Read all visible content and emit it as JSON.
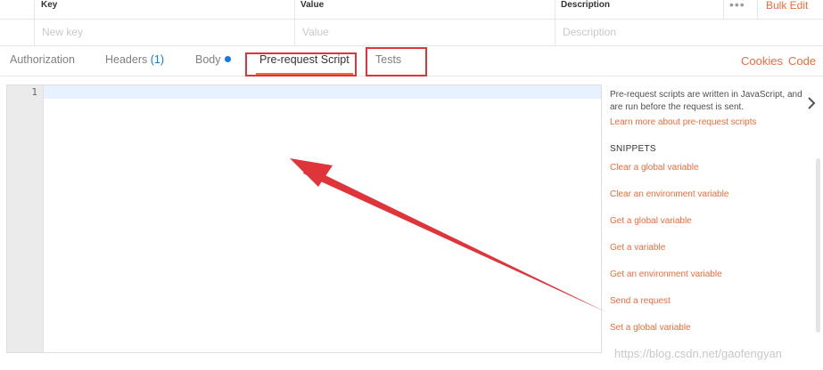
{
  "params": {
    "columns": {
      "key": "Key",
      "value": "Value",
      "description": "Description"
    },
    "more_label": "•••",
    "bulk_edit": "Bulk Edit",
    "new_row": {
      "key_placeholder": "New key",
      "value_placeholder": "Value",
      "description_placeholder": "Description"
    }
  },
  "tabs": {
    "authorization": "Authorization",
    "headers": "Headers",
    "headers_count": "(1)",
    "body": "Body",
    "prerequest": "Pre-request Script",
    "tests": "Tests",
    "cookies": "Cookies",
    "code": "Code",
    "active": "Pre-request Script"
  },
  "editor": {
    "line_number": "1",
    "content": ""
  },
  "sidebar": {
    "description": "Pre-request scripts are written in JavaScript, and are run before the request is sent.",
    "learn_more": "Learn more about pre-request scripts",
    "snippets_title": "SNIPPETS",
    "snippets": [
      "Clear a global variable",
      "Clear an environment variable",
      "Get a global variable",
      "Get a variable",
      "Get an environment variable",
      "Send a request",
      "Set a global variable"
    ]
  },
  "icons": {
    "expand": "chevron-right-icon"
  },
  "annotation_color": "#e0343b",
  "accent_color": "#f26b3a",
  "watermark": "https://blog.csdn.net/gaofengyan"
}
